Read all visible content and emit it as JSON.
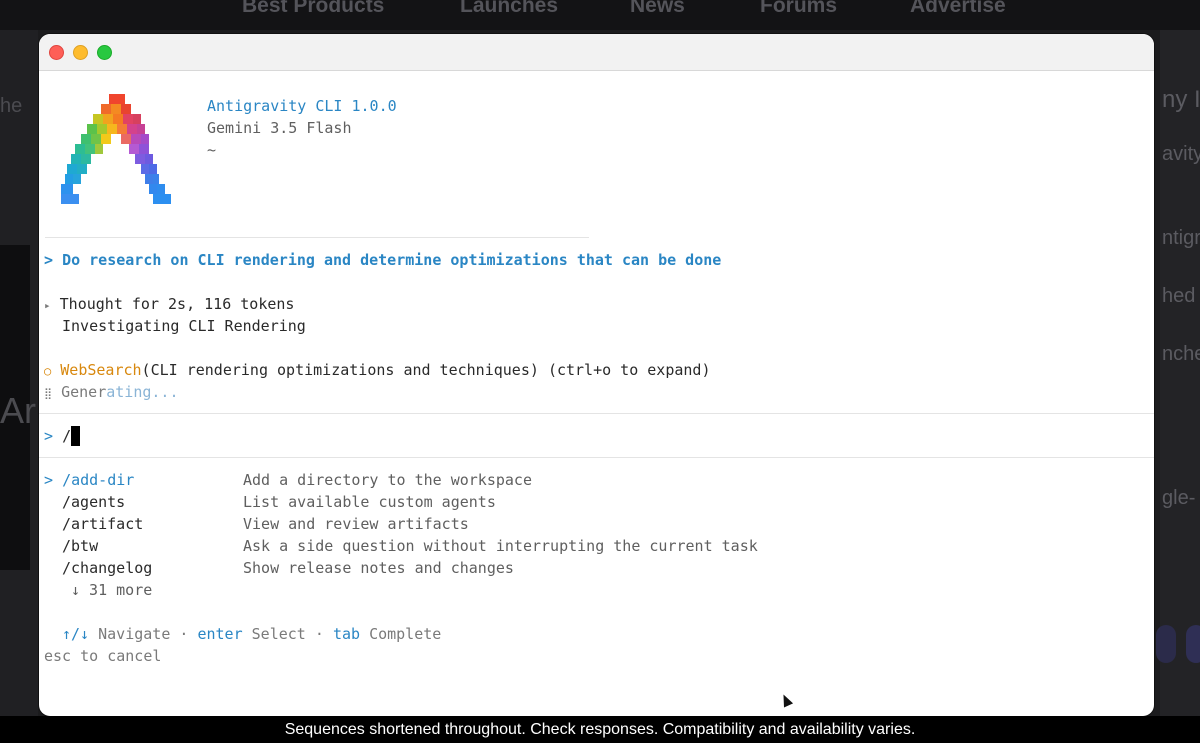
{
  "background_page": {
    "nav": [
      "Best Products",
      "Launches",
      "News",
      "Forums",
      "Advertise"
    ],
    "left_fragments": [
      "he",
      "Ar"
    ],
    "right_fragments": [
      "ny I",
      "avity",
      "ntigr",
      "hed",
      "nche",
      "gle-"
    ]
  },
  "terminal": {
    "header": {
      "app_name": "Antigravity CLI 1.0.0",
      "model": "Gemini 3.5 Flash",
      "cwd": "~"
    },
    "user_prompt": {
      "marker": ">",
      "text": "Do research on CLI rendering and determine optimizations that can be done"
    },
    "thought": {
      "marker": "▸",
      "summary": "Thought for 2s, 116 tokens",
      "detail": "Investigating CLI Rendering"
    },
    "tool_call": {
      "marker": "○",
      "tool": "WebSearch",
      "args": "(CLI rendering optimizations and techniques)",
      "hint": "(ctrl+o to expand)"
    },
    "status": {
      "marker": "⣿",
      "text_a": "Gener",
      "text_b": "ating..."
    },
    "input": {
      "marker": ">",
      "value": "/"
    },
    "commands": [
      {
        "name": "/add-dir",
        "description": "Add a directory to the workspace"
      },
      {
        "name": "/agents",
        "description": "List available custom agents"
      },
      {
        "name": "/artifact",
        "description": "View and review artifacts"
      },
      {
        "name": "/btw",
        "description": "Ask a side question without interrupting the current task"
      },
      {
        "name": "/changelog",
        "description": "Show release notes and changes"
      }
    ],
    "more": "↓ 31 more",
    "hints": {
      "nav_key": "↑/↓",
      "nav_label": "Navigate",
      "enter_key": "enter",
      "enter_label": "Select",
      "tab_key": "tab",
      "tab_label": "Complete",
      "separator": "·",
      "cancel": "esc to cancel"
    }
  },
  "caption": "Sequences shortened throughout. Check responses. Compatibility and availability varies.",
  "colors": {
    "accent_blue": "#2a86c4",
    "tool_orange": "#d8880e"
  }
}
